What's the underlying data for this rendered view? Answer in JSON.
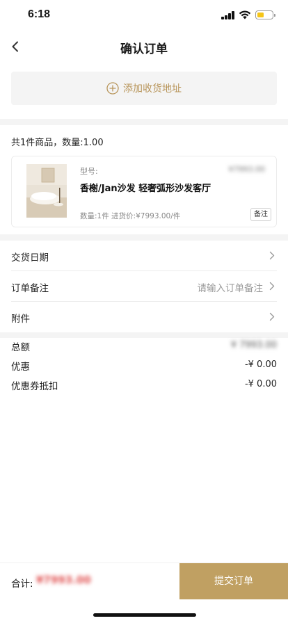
{
  "status_bar": {
    "time": "6:18"
  },
  "header": {
    "title": "确认订单"
  },
  "address": {
    "add_label": "添加收货地址"
  },
  "goods": {
    "summary": "共1件商品，数量:1.00",
    "items": [
      {
        "model_label": "型号:",
        "model_value": "¥7993.00",
        "name": "香榭/Jan沙发 轻奢弧形沙发客厅",
        "meta": "数量:1件 进货价:¥7993.00/件",
        "note_label": "备注"
      }
    ]
  },
  "fields": {
    "delivery_date": {
      "label": "交货日期"
    },
    "order_note": {
      "label": "订单备注",
      "placeholder": "请输入订单备注"
    },
    "attachment": {
      "label": "附件"
    }
  },
  "summary": {
    "total_label": "总额",
    "total_value": "¥ 7993.00",
    "discount_label": "优惠",
    "discount_value": "-¥ 0.00",
    "coupon_label": "优惠券抵扣",
    "coupon_value": "-¥ 0.00"
  },
  "footer": {
    "total_label": "合计:",
    "total_value": "¥7993.00",
    "submit_label": "提交订单"
  },
  "colors": {
    "accent": "#c0a062",
    "price_red": "#e05050",
    "section_gray": "#f4f4f4"
  },
  "icons": {
    "back": "chevron-left-icon",
    "add": "plus-circle-icon",
    "row_arrow": "chevron-right-icon"
  }
}
